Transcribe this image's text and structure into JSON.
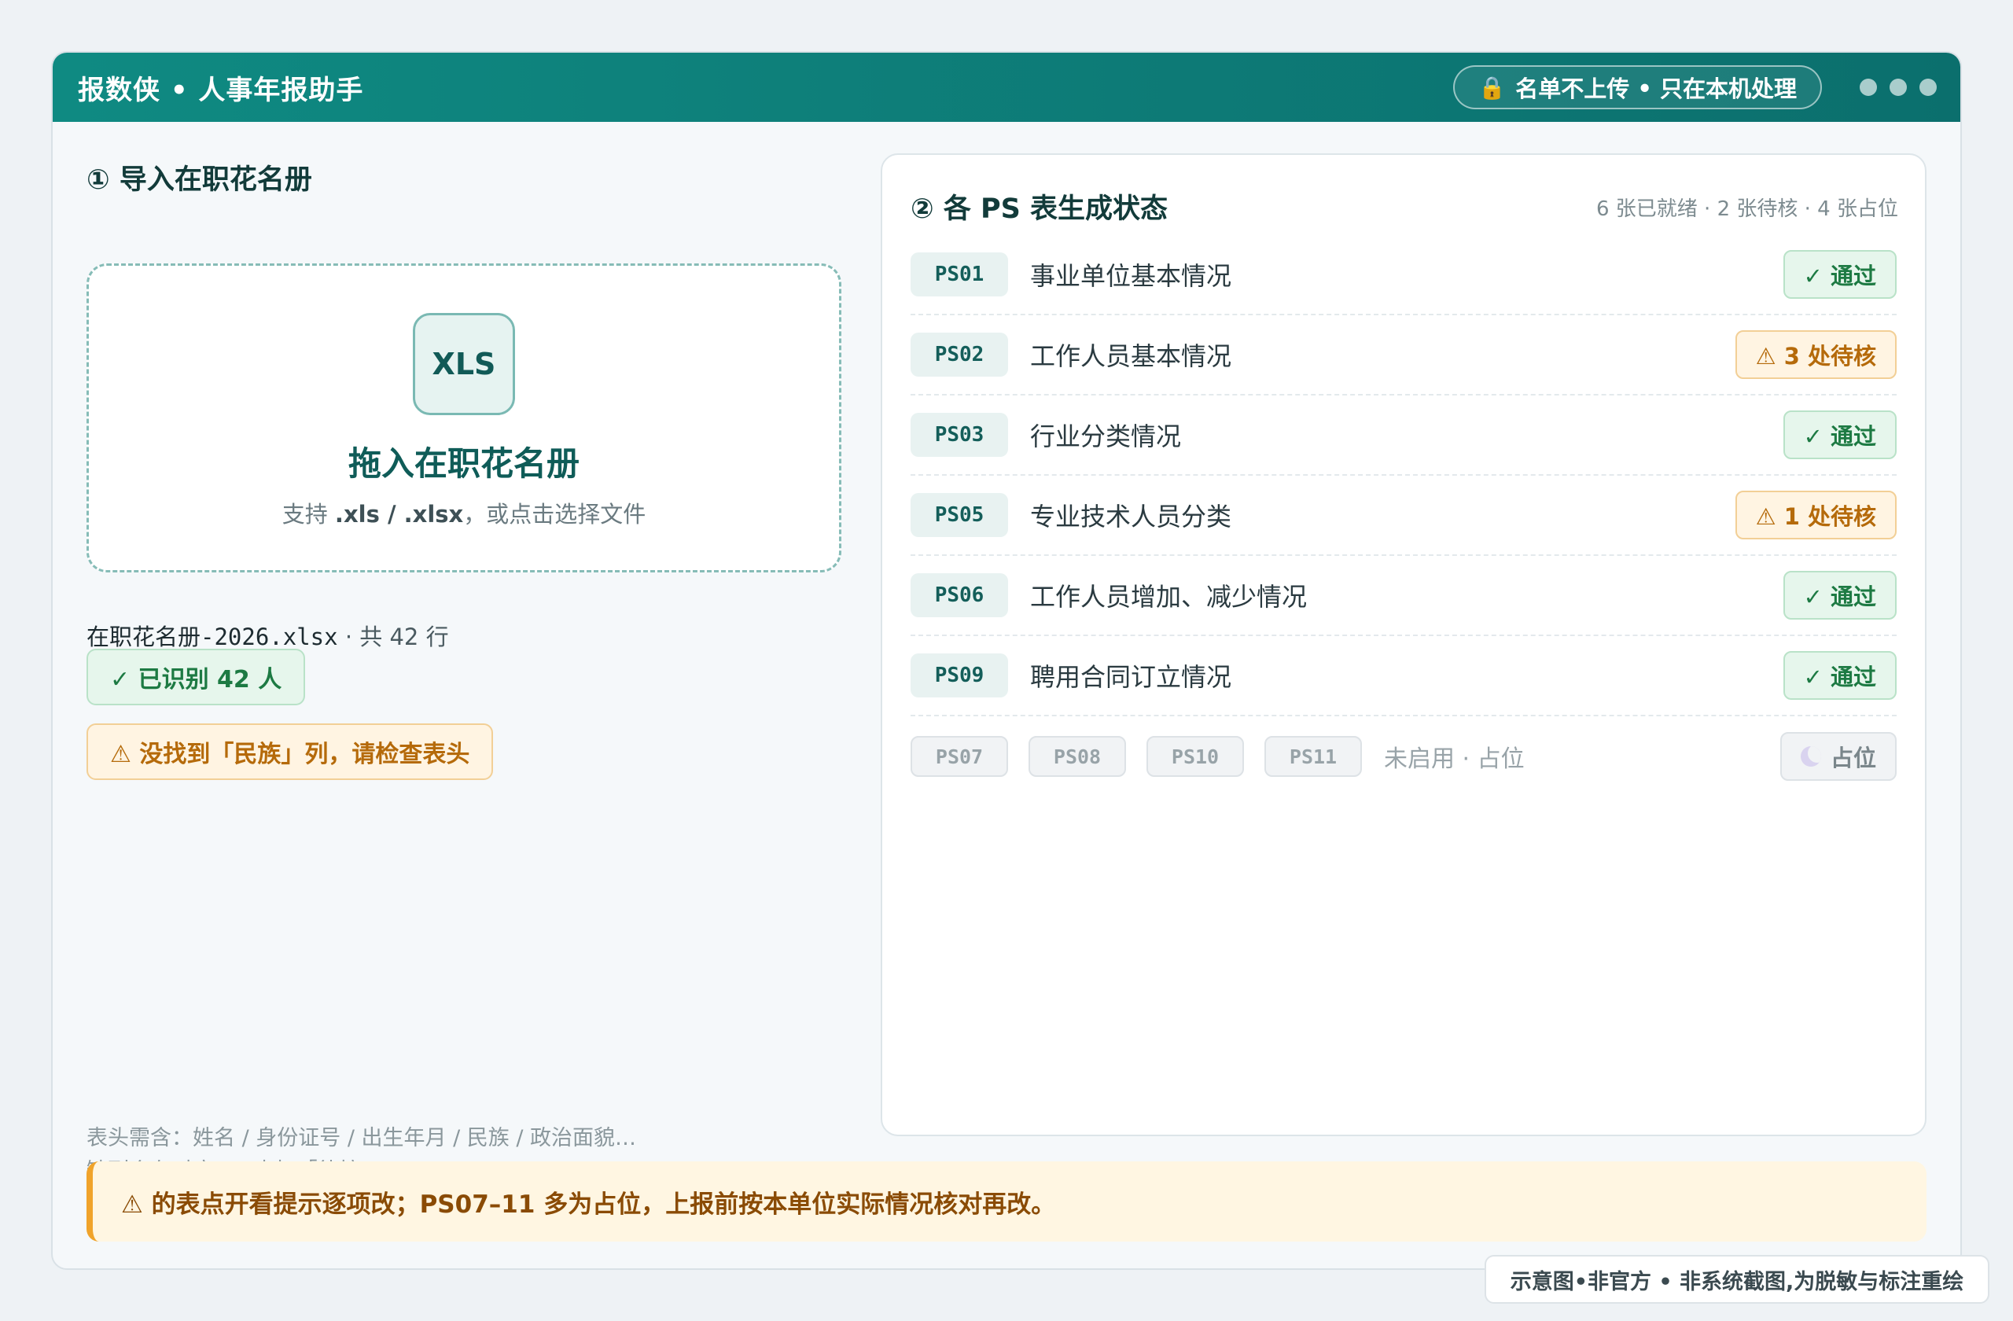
{
  "header": {
    "title": "报数侠 • 人事年报助手",
    "privacy_label": "名单不上传 • 只在本机处理"
  },
  "import_panel": {
    "title": "① 导入在职花名册",
    "dropzone": {
      "icon_text": "XLS",
      "title": "拖入在职花名册",
      "sub_prefix": "支持 ",
      "sub_formats": ".xls / .xlsx",
      "sub_suffix": "，或点击选择文件"
    },
    "file_name": "在职花名册-2026.xlsx",
    "file_rows": " · 共 42 行",
    "recognized": "✓ 已识别 42 人",
    "warning": "⚠ 没找到「民族」列，请检查表头",
    "hint_line1": "表头需含：姓名 / 身份证号 / 出生年月 / 民族 / 政治面貌…",
    "hint_line2": "缺列会在对应 PS 表标「待核」。"
  },
  "status_panel": {
    "title": "② 各 PS 表生成状态",
    "summary": "6 张已就绪 · 2 张待核 · 4 张占位",
    "rows": [
      {
        "code": "PS01",
        "name": "事业单位基本情况",
        "status": "✓ 通过"
      },
      {
        "code": "PS02",
        "name": "工作人员基本情况",
        "status": "⚠ 3 处待核"
      },
      {
        "code": "PS03",
        "name": "行业分类情况",
        "status": "✓ 通过"
      },
      {
        "code": "PS05",
        "name": "专业技术人员分类",
        "status": "⚠ 1 处待核"
      },
      {
        "code": "PS06",
        "name": "工作人员增加、减少情况",
        "status": "✓ 通过"
      },
      {
        "code": "PS09",
        "name": "聘用合同订立情况",
        "status": "✓ 通过"
      }
    ],
    "placeholder_codes": [
      "PS07",
      "PS08",
      "PS10",
      "PS11"
    ],
    "placeholder_text": "未启用 · 占位",
    "placeholder_status": "占位"
  },
  "banner": "⚠ 的表点开看提示逐项改；PS07–11 多为占位，上报前按本单位实际情况核对再改。",
  "watermark": "示意图•非官方 • 非系统截图,为脱敏与标注重绘"
}
